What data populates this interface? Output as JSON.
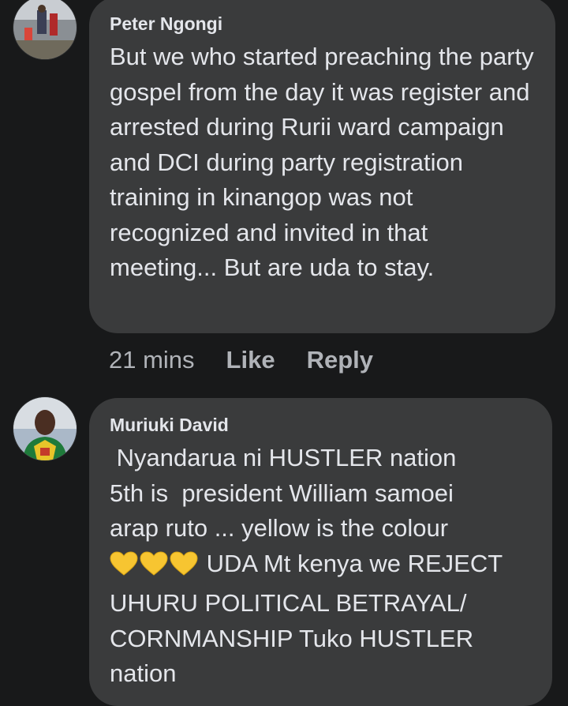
{
  "comments": [
    {
      "author": "Peter Ngongi",
      "avatar_icon": "profile-photo-icon",
      "text": "But we who started preaching the party gospel from the day it was register and arrested during Rurii ward campaign and DCI during party registration training in kinangop was not recognized and invited in that meeting... But are uda to stay.",
      "time": "21 mins",
      "like_label": "Like",
      "reply_label": "Reply"
    },
    {
      "author": "Muriuki David",
      "avatar_icon": "profile-photo-icon",
      "text_lines": [
        " Nyandarua ni HUSTLER nation",
        "5th is  president William samoei",
        "arap ruto ... yellow is the colour"
      ],
      "hearts": [
        "yellow-heart-icon",
        "yellow-heart-icon",
        "yellow-heart-icon"
      ],
      "text_after_hearts": " UDA Mt kenya we REJECT UHURU POLITICAL BETRAYAL/ CORNMANSHIP Tuko HUSTLER nation"
    }
  ],
  "colors": {
    "background": "#18191a",
    "bubble": "#3a3b3c",
    "text": "#e4e6eb",
    "secondary_text": "#b0b3b8",
    "heart": "#f7c531"
  }
}
